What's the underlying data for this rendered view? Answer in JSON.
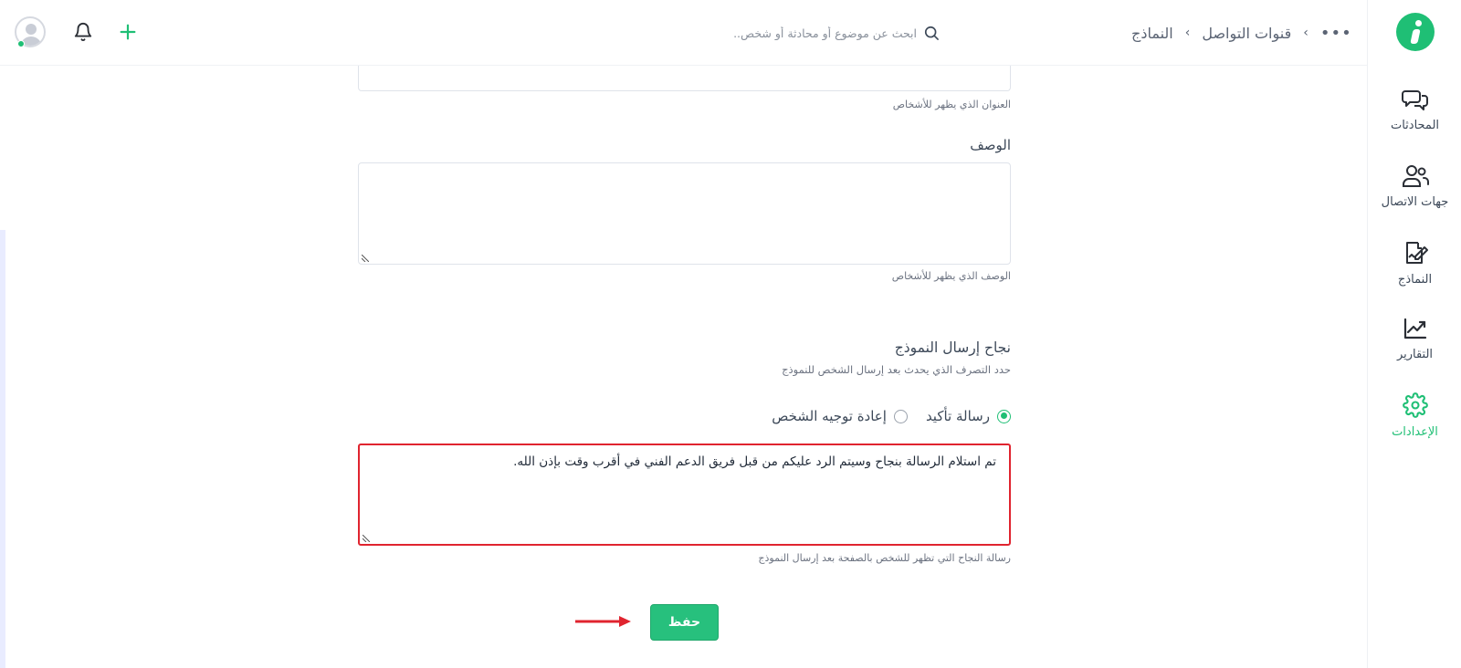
{
  "header": {
    "breadcrumb": [
      "قنوات التواصل",
      "النماذج"
    ],
    "breadcrumb_sep": "›",
    "more": "•••",
    "search_placeholder": "ابحث عن موضوع أو محادثة أو شخص.."
  },
  "sidebar": {
    "items": [
      {
        "label": "المحادثات",
        "icon": "chat-bubbles-icon"
      },
      {
        "label": "جهات الاتصال",
        "icon": "contacts-icon"
      },
      {
        "label": "النماذج",
        "icon": "form-edit-icon"
      },
      {
        "label": "التقارير",
        "icon": "chart-trend-icon"
      },
      {
        "label": "الإعدادات",
        "icon": "gear-icon",
        "active": true
      }
    ]
  },
  "form": {
    "title_hint": "العنوان الذي يظهر للأشخاص",
    "description_label": "الوصف",
    "description_value": "",
    "description_hint": "الوصف الذي يظهر للأشخاص",
    "success_title": "نجاح إرسال النموذج",
    "success_subtitle": "حدد التصرف الذي يحدث بعد إرسال الشخص للنموذج",
    "radio_confirmation": "رسالة تأكيد",
    "radio_redirect": "إعادة توجيه الشخص",
    "selected_option": "رسالة تأكيد",
    "success_message": "تم استلام الرسالة بنجاح وسيتم الرد عليكم من قبل فريق الدعم الفني في أقرب وقت بإذن الله.",
    "success_message_hint": "رسالة النجاح التي تظهر للشخص بالصفحة بعد إرسال النموذج",
    "save_label": "حفظ"
  },
  "colors": {
    "accent": "#1fbf75",
    "highlight_border": "#e0242f",
    "arrow": "#e0242f"
  }
}
